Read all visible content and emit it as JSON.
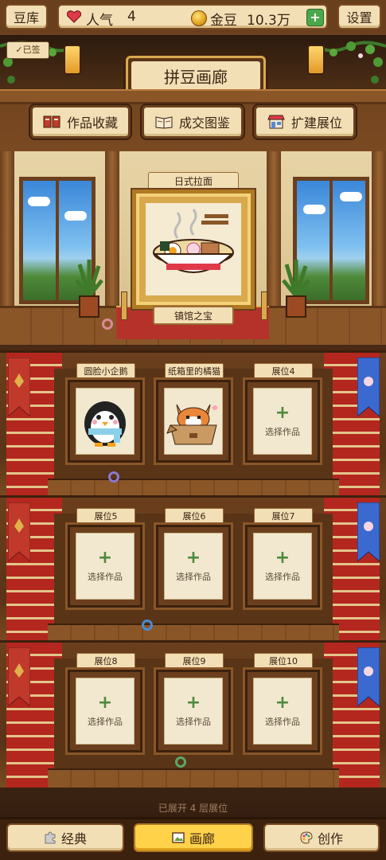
{
  "topbar": {
    "douku_label": "豆库",
    "popularity_label": "人气",
    "popularity_value": "4",
    "coins_label": "金豆",
    "coins_value": "10.3万",
    "add_label": "+",
    "settings_label": "设置",
    "signed_label": "✓已签"
  },
  "header": {
    "title": "拼豆画廊",
    "menu": [
      {
        "label": "作品收藏",
        "icon": "book-icon"
      },
      {
        "label": "成交图鉴",
        "icon": "open-book-icon"
      },
      {
        "label": "扩建展位",
        "icon": "shop-icon"
      }
    ]
  },
  "featured": {
    "title": "日式拉面",
    "plaque": "镇馆之宝"
  },
  "slots": [
    {
      "label": "圆脸小企鹅",
      "filled": true,
      "art": "penguin"
    },
    {
      "label": "纸箱里的橘猫",
      "filled": true,
      "art": "cat"
    },
    {
      "label": "展位4",
      "filled": false
    },
    {
      "label": "展位5",
      "filled": false
    },
    {
      "label": "展位6",
      "filled": false
    },
    {
      "label": "展位7",
      "filled": false
    },
    {
      "label": "展位8",
      "filled": false
    },
    {
      "label": "展位9",
      "filled": false
    },
    {
      "label": "展位10",
      "filled": false
    }
  ],
  "empty_slot": {
    "plus": "+",
    "hint": "选择作品"
  },
  "footer_note": "已展开 4 层展位",
  "nav": [
    {
      "label": "经典",
      "active": false
    },
    {
      "label": "画廊",
      "active": true
    },
    {
      "label": "创作",
      "active": false
    }
  ],
  "colors": {
    "wood": "#6b3f1d",
    "parchment": "#f2dfb5",
    "carpet": "#b3271f",
    "gold": "#d9a94e",
    "active_tab": "#ffd24a"
  }
}
